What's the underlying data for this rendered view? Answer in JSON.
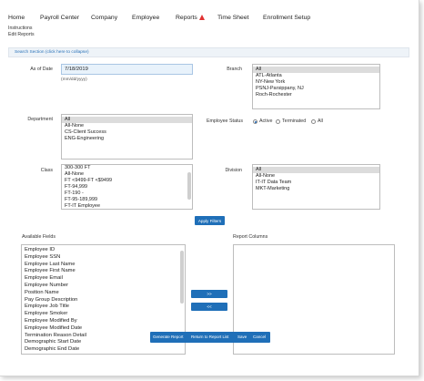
{
  "nav": {
    "items": [
      "Home",
      "Payroll Center",
      "Company",
      "Employee",
      "Reports",
      "Time Sheet",
      "Enrollment Setup"
    ],
    "reports_alert_icon": "warning-icon",
    "alert_color": "#e03131"
  },
  "sublinks": {
    "instructions": "Instructions",
    "edit_reports": "Edit Reports"
  },
  "section": {
    "label": "Search Section (click here to collapse)"
  },
  "as_of_date": {
    "label": "As of Date",
    "value": "7/18/2019",
    "hint": "(mm/dd/yyyy)"
  },
  "branch": {
    "label": "Branch",
    "options": [
      "All",
      "ATL-Atlanta",
      "NY-New York",
      "PSNJ-Parsippany, NJ",
      "Roch-Rochester"
    ],
    "selected": "All"
  },
  "department": {
    "label": "Department",
    "options": [
      "All",
      "All-None",
      "CS-Client Success",
      "ENG-Engineering"
    ],
    "selected": "All"
  },
  "employee_status": {
    "label": "Employee Status",
    "options": [
      "Active",
      "Terminated",
      "All"
    ],
    "selected": "Active"
  },
  "class": {
    "label": "Class",
    "options": [
      "300-300 FT",
      "All-None",
      "FT <9499-FT <$9499",
      "FT-94,999",
      "FT-190 -",
      "FT-95-189,999",
      "FT-IT Employee"
    ]
  },
  "division": {
    "label": "Division",
    "options": [
      "All",
      "All-None",
      "IT-IT Data Team",
      "MKT-Marketing"
    ],
    "selected": "All"
  },
  "apply_filters": "Apply Filters",
  "available_fields": {
    "label": "Available Fields",
    "items": [
      "Employee ID",
      "Employee SSN",
      "Employee Last Name",
      "Employee First Name",
      "Employee Email",
      "Employee Number",
      "Position Name",
      "Pay Group Description",
      "Employee Job Title",
      "Employee Smoker",
      "Employee Modified By",
      "Employee Modified Date",
      "Termination Reason Detail",
      "Demographic Start Date",
      "Demographic End Date"
    ]
  },
  "report_columns": {
    "label": "Report Columns",
    "items": []
  },
  "move_buttons": {
    "add": ">>",
    "remove": "<<"
  },
  "actions": {
    "generate": "Generate Report",
    "return": "Return to Report List",
    "save": "Save",
    "cancel": "Cancel"
  },
  "colors": {
    "accent": "#1f6fb8",
    "date_input_bg": "#e8f2fb",
    "selected_option": "#dcdcdc"
  }
}
